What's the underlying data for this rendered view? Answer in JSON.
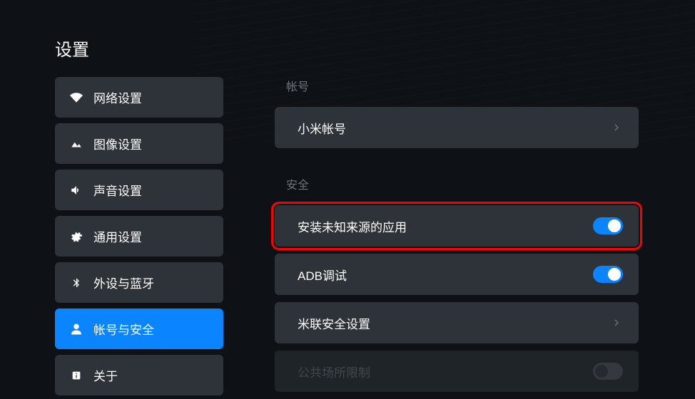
{
  "page_title": "设置",
  "sidebar": {
    "items": [
      {
        "label": "网络设置",
        "icon": "wifi"
      },
      {
        "label": "图像设置",
        "icon": "image"
      },
      {
        "label": "声音设置",
        "icon": "sound"
      },
      {
        "label": "通用设置",
        "icon": "gear"
      },
      {
        "label": "外设与蓝牙",
        "icon": "bluetooth"
      },
      {
        "label": "帐号与安全",
        "icon": "person",
        "active": true
      },
      {
        "label": "关于",
        "icon": "info"
      }
    ]
  },
  "content": {
    "section_account": "帐号",
    "xiaomi_account": "小米帐号",
    "section_security": "安全",
    "unknown_sources": "安装未知来源的应用",
    "adb_debug": "ADB调试",
    "milink_security": "米联安全设置",
    "public_place_limit": "公共场所限制"
  },
  "toggles": {
    "unknown_sources": true,
    "adb_debug": true,
    "public_place_limit": false
  }
}
